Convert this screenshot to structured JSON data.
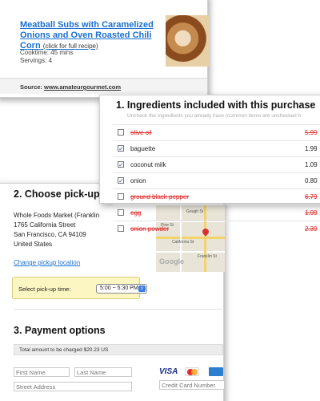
{
  "recipe": {
    "title": "Meatball Subs with Caramelized Onions and Oven Roasted Chili Corn",
    "link_note": "(click for full recipe)",
    "cooktime": "Cooktime: 45 mins",
    "servings": "Servings: 4",
    "source_label": "Source:",
    "source_url": "www.amateurgourmet.com"
  },
  "ingredients": {
    "title": "1. Ingredients included with this purchase",
    "note": "Uncheck the ingredients you already have (common items are unchecked b",
    "items": [
      {
        "name": "olive oil",
        "price": "5.99",
        "checked": false
      },
      {
        "name": "baguette",
        "price": "1.99",
        "checked": true
      },
      {
        "name": "coconut milk",
        "price": "1.09",
        "checked": true
      },
      {
        "name": "onion",
        "price": "0.80",
        "checked": true
      },
      {
        "name": "ground black pepper",
        "price": "6.79",
        "checked": false
      },
      {
        "name": "egg",
        "price": "1.99",
        "checked": false
      },
      {
        "name": "onion powder",
        "price": "2.39",
        "checked": false
      }
    ]
  },
  "pickup": {
    "title": "2. Choose pick-up",
    "store_name": "Whole Foods Market (Franklin",
    "street": "1765 California Street",
    "city": "San Francisco, CA 94109",
    "country": "United States",
    "change_link": "Change pickup location",
    "time_label": "Select pick-up time:",
    "time_value": "5:00 ~ 5:30 PM",
    "map_labels": [
      "California St",
      "Pine St",
      "Franklin St",
      "Gough St",
      "Google"
    ]
  },
  "payment": {
    "title": "3. Payment options",
    "total": "Total amount to be charged $20.23 US",
    "first_name_placeholder": "First Name",
    "last_name_placeholder": "Last Name",
    "street_placeholder": "Street Address",
    "card_placeholder": "Credit Card Number",
    "card_visa": "VISA"
  },
  "colors": {
    "link": "#1a6fd1",
    "removed": "#e02a2a",
    "pickup_box": "#fbf6c2"
  }
}
